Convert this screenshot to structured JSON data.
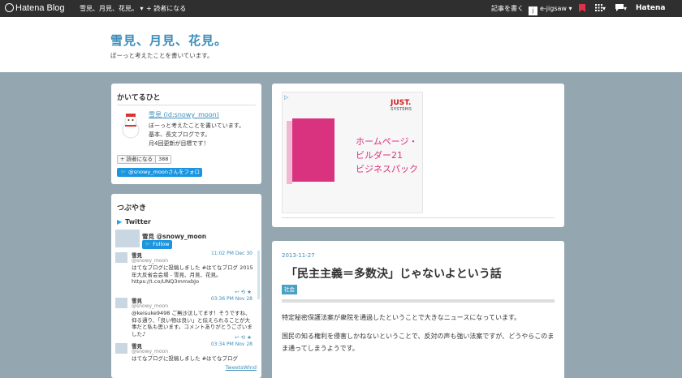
{
  "topbar": {
    "logo": "Hatena Blog",
    "blog_selector": "雪見、月見、花見。 ▾",
    "reader_button": "+ 読者になる",
    "write_article": "記事を書く",
    "user_initial": "j",
    "user_name": "e-jigsaw ▾",
    "hatena_brand": "Hatena"
  },
  "header": {
    "title": "雪見、月見、花見。",
    "description": "ぼーっと考えたことを書いています。"
  },
  "author": {
    "section_title": "かいてるひと",
    "name": "雪見 (id:snowy_moon)",
    "bio": [
      "ぼーっと考えたことを書いています。",
      "基本、長文ブログです。",
      "月4回更新が目標です！"
    ],
    "reader_button": "+ 読者になる",
    "reader_count": "388",
    "twitter_follow": "@snowy_moonさんをフォロー"
  },
  "tweets_widget": {
    "section_title": "つぶやき",
    "header": "Twitter",
    "profile_name": "雪見 @snowy_moon",
    "follow_label": "Follow",
    "footer": "TweetsWind",
    "tweets": [
      {
        "name": "雪見",
        "handle": "@snowy_moon",
        "time": "11:02 PM Dec 30",
        "text": "はてなブログに投稿しました #はてなブログ 2015年大反省会会場 - 雪見、月見、花見。 https://t.co/UNQ3mmxbJo"
      },
      {
        "name": "雪見",
        "handle": "@snowy_moon",
        "time": "03:36 PM Nov 28",
        "text": "@keisuke9498 ご無沙汰してます！そうですね、仰る通り、「良い物は良い」と伝えられることが大事だと私も思います。コメントありがとうございました♪"
      },
      {
        "name": "雪見",
        "handle": "@snowy_moon",
        "time": "03:34 PM Nov 28",
        "text": "はてなブログに投稿しました #はてなブログ"
      }
    ]
  },
  "ad": {
    "info_icon": "adchoices-icon",
    "logo": "JUST.",
    "logo_sub": "SYSTEMS",
    "product_line1": "ホームページ・",
    "product_line2": "ビルダー21",
    "product_line3": "ビジネスパック"
  },
  "entry": {
    "date": "2013-11-27",
    "title": "「民主主義＝多数決」じゃないよという話",
    "category": "社会",
    "paragraphs": [
      "特定秘密保護法案が衆院を通過したということで大きなニュースになっています。",
      "国民の知る権利を侵害しかねないということで、反対の声も強い法案ですが、どうやらこのまま通ってしまうようです。"
    ]
  },
  "colors": {
    "accent": "#3c8db8",
    "background": "#94a7b0",
    "topbar": "#2f2f2f",
    "twitter": "#1b95e0",
    "ad_pink": "#d9337f"
  }
}
